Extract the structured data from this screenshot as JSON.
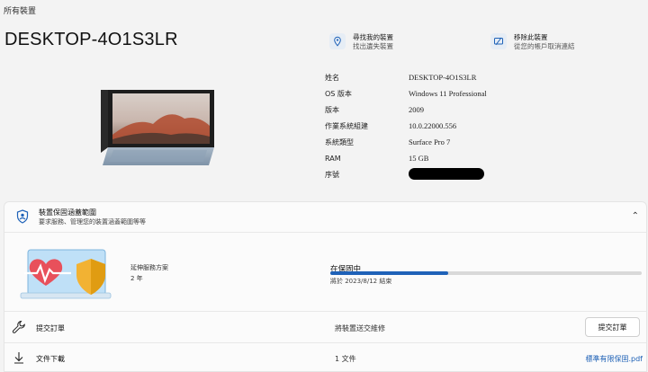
{
  "breadcrumb": "所有裝置",
  "device_name": "DESKTOP-4O1S3LR",
  "actions": [
    {
      "title": "尋找我的裝置",
      "subtitle": "找出遺失裝置",
      "icon": "location-icon"
    },
    {
      "title": "移除此裝置",
      "subtitle": "從您的帳戶取消連結",
      "icon": "unlink-device-icon"
    }
  ],
  "specs": [
    {
      "label": "姓名",
      "value": "DESKTOP-4O1S3LR"
    },
    {
      "label": "OS 版本",
      "value": "Windows 11 Professional"
    },
    {
      "label": "版本",
      "value": "2009"
    },
    {
      "label": "作業系統組建",
      "value": "10.0.22000.556"
    },
    {
      "label": "系統類型",
      "value": "Surface Pro 7"
    },
    {
      "label": "RAM",
      "value": "15 GB"
    },
    {
      "label": "序號",
      "value": ""
    }
  ],
  "coverage": {
    "title": "裝置保固涵蓋範圍",
    "subtitle": "要求服務、管理您的裝置涵蓋範圍等等",
    "plan_name": "延伸服務方案",
    "plan_duration": "2 年",
    "status": "在保固中",
    "progress": 0.38,
    "ends": "將於 2023/8/12 結束"
  },
  "rows": [
    {
      "label": "提交訂單",
      "middle": "將裝置送交維修",
      "button": "提交訂單",
      "icon": "wrench-icon"
    },
    {
      "label": "文件下載",
      "middle": "1 文件",
      "link": "標準有限保固.pdf",
      "icon": "download-icon"
    }
  ],
  "colors": {
    "accent": "#1f62b8",
    "link": "#1b5fb5"
  }
}
